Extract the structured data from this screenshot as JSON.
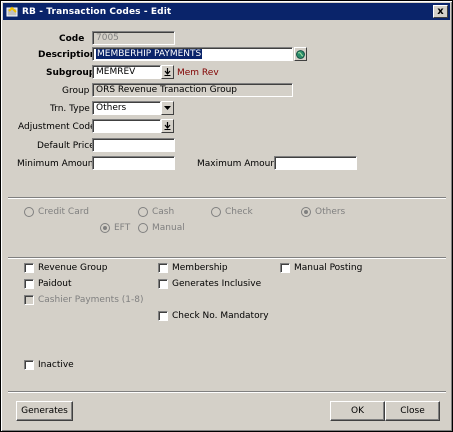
{
  "window": {
    "title": "RB - Transaction Codes - Edit",
    "close_label": "x"
  },
  "form": {
    "code_label": "Code",
    "code_value": "7005",
    "description_label": "Description",
    "description_value": "MEMBERHIP PAYMENTS",
    "subgroup_label": "Subgroup",
    "subgroup_value": "MEMREV",
    "subgroup_desc": "Mem Rev",
    "group_label": "Group",
    "group_value": "ORS Revenue Tranaction Group",
    "trn_type_label": "Trn. Type",
    "trn_type_value": "Others",
    "adjustment_code_label": "Adjustment Code",
    "adjustment_code_value": "",
    "default_price_label": "Default Price",
    "default_price_value": "",
    "min_amount_label": "Minimum Amount",
    "min_amount_value": "",
    "max_amount_label": "Maximum Amount",
    "max_amount_value": ""
  },
  "payment_types": {
    "credit_card": "Credit Card",
    "cash": "Cash",
    "check": "Check",
    "others": "Others",
    "eft": "EFT",
    "manual": "Manual",
    "selected": [
      "Others",
      "EFT"
    ]
  },
  "options": {
    "revenue_group": "Revenue Group",
    "membership": "Membership",
    "manual_posting": "Manual Posting",
    "paidout": "Paidout",
    "generates_inclusive": "Generates Inclusive",
    "cashier_payments": "Cashier Payments (1-8)",
    "check_no_mandatory": "Check No. Mandatory",
    "inactive": "Inactive"
  },
  "buttons": {
    "generates": "Generates",
    "ok": "OK",
    "close": "Close"
  },
  "colors": {
    "titlebar": "#0a246a",
    "face": "#d4d0c8",
    "highlight": "#0a246a",
    "memrev_text": "#800000"
  }
}
